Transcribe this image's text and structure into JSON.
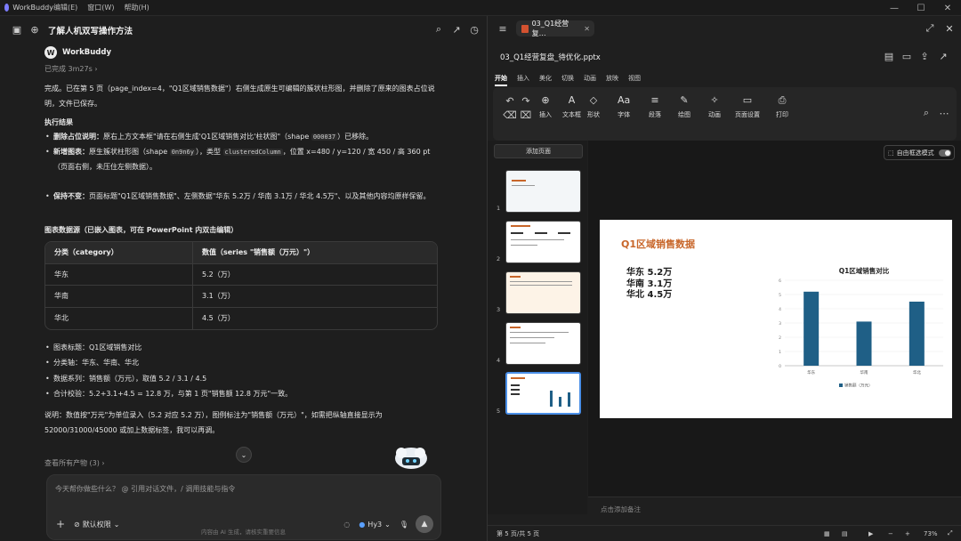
{
  "menubar": {
    "app_name": "WorkBuddy",
    "items": [
      "编辑(E)",
      "窗口(W)",
      "帮助(H)"
    ]
  },
  "chat": {
    "title": "了解人机双写操作方法",
    "bot_name": "WorkBuddy",
    "done_label": "已完成 3m27s ›",
    "intro": "完成。已在第 5 页（page_index=4，\"Q1区域销售数据\"）右侧生成原生可编辑的簇状柱形图，并删除了原来的图表占位说明，文件已保存。",
    "exec_heading": "执行结果",
    "exec_items": [
      {
        "a": "删除占位说明：",
        "b": "原右上方文本框\"请在右侧生成'Q1区域销售对比'柱状图\"（shape ",
        "code": "000037",
        "c": "）已移除。"
      },
      {
        "a": "新增图表：",
        "b": "原生簇状柱形图（shape ",
        "code": "0n9n6y",
        "c": "），类型 ",
        "code2": "clusteredColumn",
        "d": "，位置 x=480 / y=120 / 宽 450 / 高 360 pt（页面右侧，未压住左侧数据）。"
      },
      {
        "a": "保持不变：",
        "b": "页面标题\"Q1区域销售数据\"、左侧数据\"华东 5.2万 / 华南 3.1万 / 华北 4.5万\"、以及其他内容均原样保留。"
      }
    ],
    "source_heading": "图表数据源（已嵌入图表，可在 PowerPoint 内双击编辑）",
    "table": {
      "headers": [
        "分类（category）",
        "数值（series \"销售额（万元）\"）"
      ],
      "rows": [
        [
          "华东",
          "5.2（万）"
        ],
        [
          "华南",
          "3.1（万）"
        ],
        [
          "华北",
          "4.5（万）"
        ]
      ]
    },
    "summary": [
      "图表标题：Q1区域销售对比",
      "分类轴：华东、华南、华北",
      "数据系列：销售额（万元），取值 5.2 / 3.1 / 4.5",
      "合计校验：5.2+3.1+4.5 = 12.8 万，与第 1 页\"销售额 12.8 万元\"一致。"
    ],
    "note": "说明：数值按\"万元\"为单位录入（5.2 对应 5.2 万），图例标注为\"销售额（万元）\"，如需把纵轴直接显示为 52000/31000/45000 或加上数据标签，我可以再调。",
    "all_outputs": "查看所有产物 (3) ›",
    "input_placeholder": "今天帮你做些什么？ @ 引用对话文件，/ 调用技能与指令",
    "permission": "默认权限",
    "model": "Hy3",
    "disclaimer": "内容由 AI 生成，请核实重要信息"
  },
  "ppt": {
    "tab_label": "03_Q1经营复…",
    "file_name": "03_Q1经营复盘_待优化.pptx",
    "ribbon_tabs": [
      "开始",
      "插入",
      "美化",
      "切换",
      "动画",
      "放映",
      "视图"
    ],
    "ribbon_buttons": [
      "插入",
      "文本框",
      "形状",
      "字体",
      "段落",
      "绘图",
      "动画",
      "页面设置",
      "打印"
    ],
    "add_page": "添加页面",
    "thumb_numbers": [
      "1",
      "2",
      "3",
      "4",
      "5"
    ],
    "free_mode": "自由框选模式",
    "slide": {
      "title": "Q1区域销售数据",
      "lines": [
        "华东 5.2万",
        "华南 3.1万",
        "华北 4.5万"
      ]
    },
    "notes_placeholder": "点击添加备注",
    "status_page": "第 5 页/共 5 页",
    "zoom": "73%"
  },
  "chart_data": {
    "type": "bar",
    "title": "Q1区域销售对比",
    "categories": [
      "华东",
      "华南",
      "华北"
    ],
    "series": [
      {
        "name": "销售额（万元）",
        "values": [
          5.2,
          3.1,
          4.5
        ]
      }
    ],
    "ylim": [
      0,
      6
    ],
    "yticks": [
      "0",
      "1",
      "2",
      "3",
      "4",
      "5",
      "6"
    ],
    "color": "#1f5f86",
    "legend": "bottom"
  }
}
